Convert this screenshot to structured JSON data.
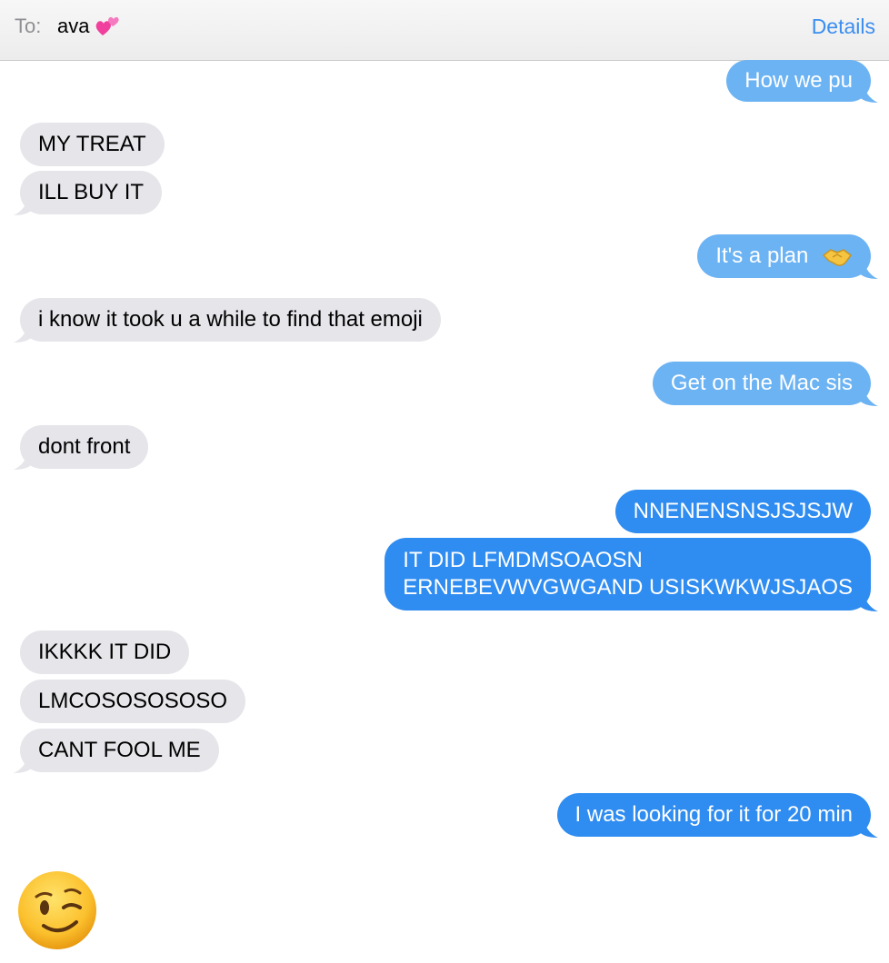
{
  "header": {
    "to_label": "To:",
    "recipient": "ava",
    "recipient_emoji": "two-hearts-icon",
    "details_label": "Details"
  },
  "messages": [
    {
      "side": "out",
      "text": "How we pu"
    },
    {
      "side": "in",
      "text": "MY TREAT"
    },
    {
      "side": "in",
      "text": "ILL BUY IT"
    },
    {
      "side": "out",
      "text": "It's a plan",
      "emoji": "handshake-icon"
    },
    {
      "side": "in",
      "text": "i know it took u a while to find that emoji"
    },
    {
      "side": "out",
      "text": "Get on the Mac sis"
    },
    {
      "side": "in",
      "text": "dont front"
    },
    {
      "side": "out",
      "text": "NNENENSNSJSJSJW"
    },
    {
      "side": "out",
      "lines": [
        "IT DID LFMDMSOAOSN",
        "ERNEBEVWVGWGAND USISKWKWJSJAOS"
      ]
    },
    {
      "side": "in",
      "text": "IKKKK IT DID"
    },
    {
      "side": "in",
      "text": "LMCOSOSOSOSO"
    },
    {
      "side": "in",
      "text": "CANT FOOL ME"
    },
    {
      "side": "out",
      "text": "I was looking for it for 20 min"
    },
    {
      "side": "in",
      "emoji": "winking-face-icon"
    }
  ],
  "colors": {
    "outgoing": "#2f8cf0",
    "outgoing_light": "#6cb3f3",
    "incoming": "#e5e5ea",
    "link": "#3b8ef0"
  }
}
